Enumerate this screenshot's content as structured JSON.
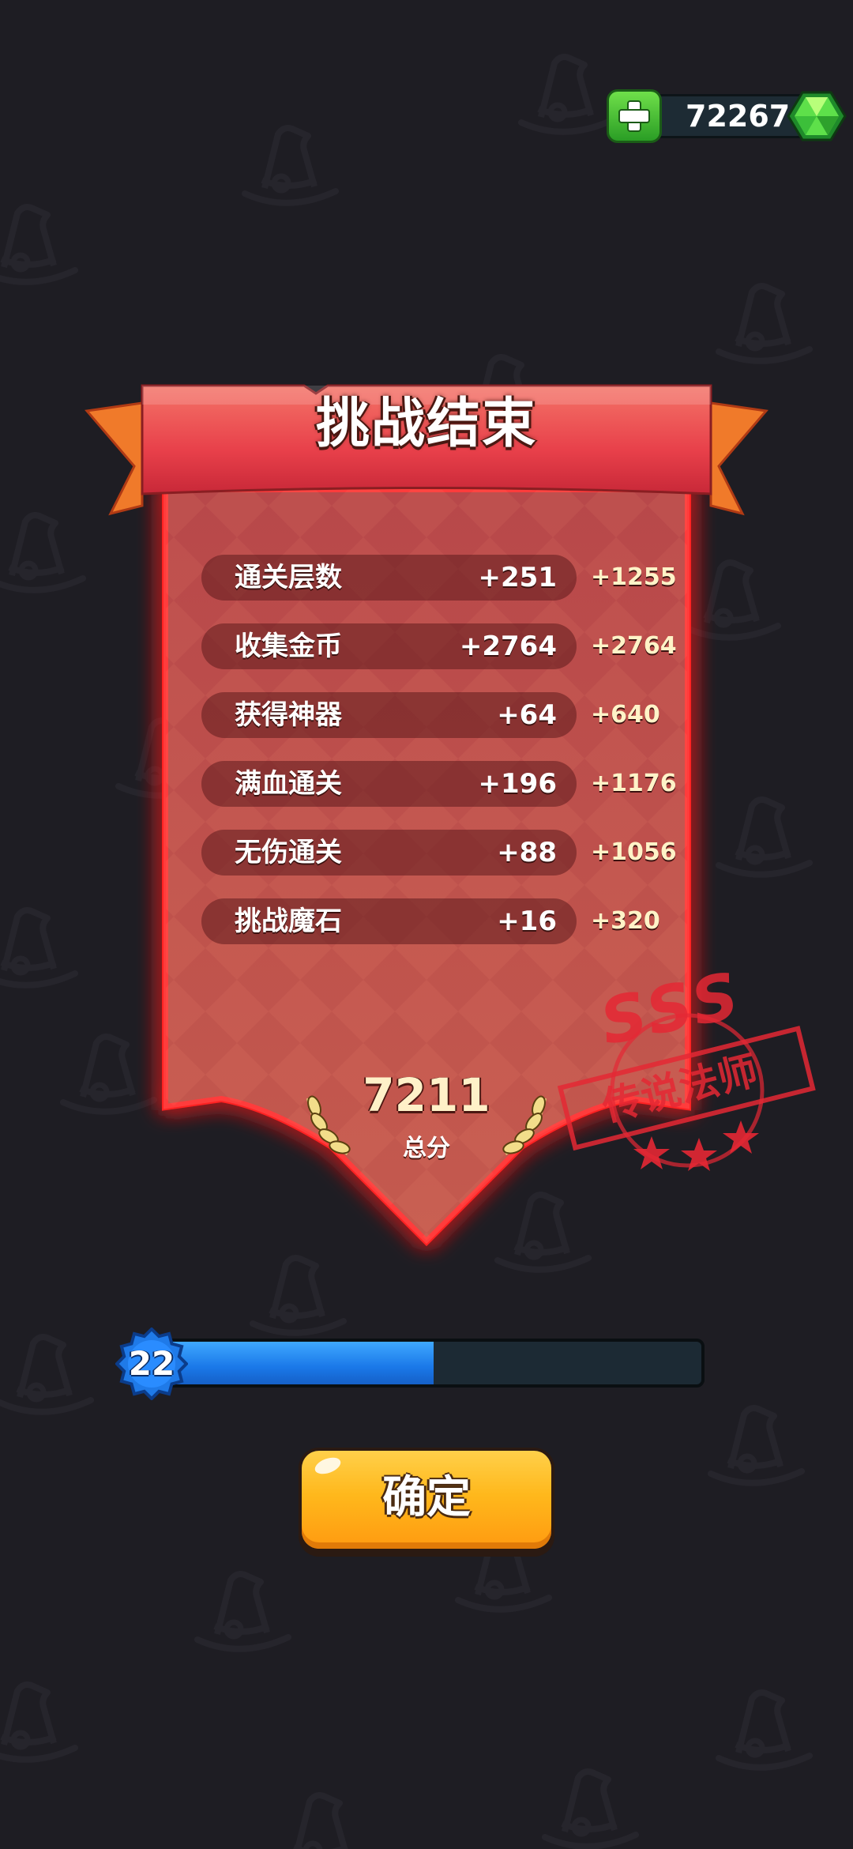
{
  "currency": {
    "amount": "72267",
    "plus_icon": "plus-icon",
    "gem_icon": "green-gem-icon"
  },
  "result_panel": {
    "title": "挑战结束",
    "rows": [
      {
        "label": "通关层数",
        "value": "+251",
        "bonus": "+1255"
      },
      {
        "label": "收集金币",
        "value": "+2764",
        "bonus": "+2764"
      },
      {
        "label": "获得神器",
        "value": "+64",
        "bonus": "+640"
      },
      {
        "label": "满血通关",
        "value": "+196",
        "bonus": "+1176"
      },
      {
        "label": "无伤通关",
        "value": "+88",
        "bonus": "+1056"
      },
      {
        "label": "挑战魔石",
        "value": "+16",
        "bonus": "+320"
      }
    ],
    "total_score": "7211",
    "total_label": "总分",
    "laurel_icon": "laurel-icon"
  },
  "rank_stamp": {
    "grade": "SSS",
    "title": "传说法师",
    "stars": 3
  },
  "level": {
    "number": "22",
    "progress": 0.5
  },
  "confirm_button": {
    "label": "确定"
  },
  "colors": {
    "background": "#1e1d23",
    "banner_red": "#e8404a",
    "panel_red": "#c8504c",
    "glow_red": "#ff2a2a",
    "stamp_red": "#e42834",
    "xp_blue": "#1a78e8",
    "button_orange": "#ffb81c",
    "gem_green": "#52d84a"
  }
}
